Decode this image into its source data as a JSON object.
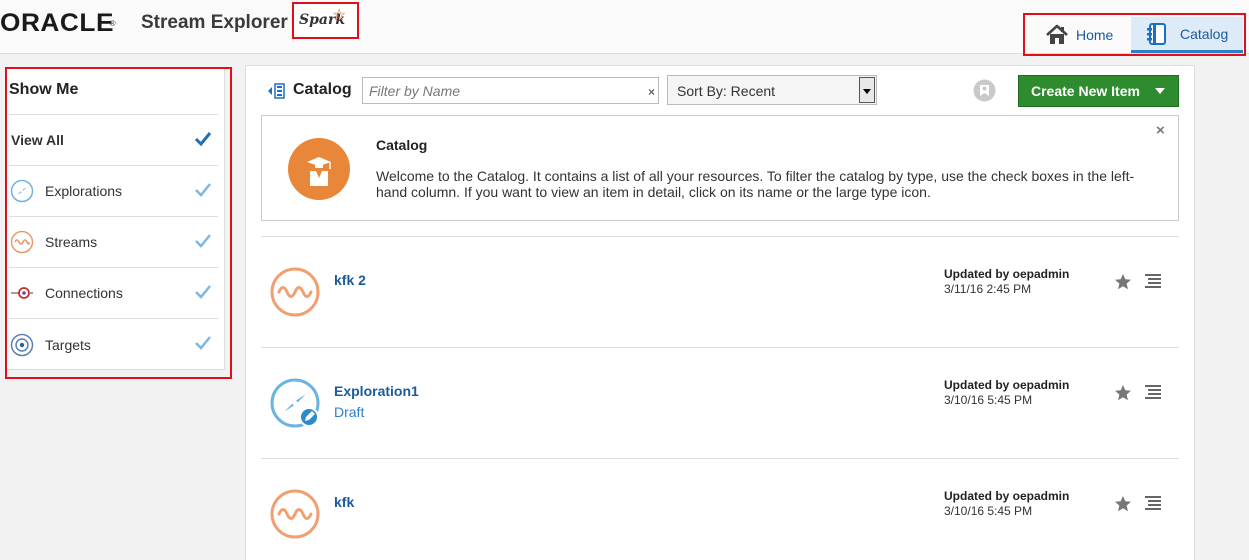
{
  "header": {
    "oracle_logo": "ORACLE",
    "oracle_reg": "®",
    "app_title": "Stream Explorer",
    "spark_logo": "Spark",
    "nav": [
      {
        "label": "Home",
        "icon": "home-icon",
        "active": false
      },
      {
        "label": "Catalog",
        "icon": "catalog-icon",
        "active": true
      }
    ]
  },
  "sidebar": {
    "title": "Show Me",
    "items": [
      {
        "label": "View All",
        "icon": "",
        "checked": true
      },
      {
        "label": "Explorations",
        "icon": "exploration-icon",
        "checked": true
      },
      {
        "label": "Streams",
        "icon": "stream-icon",
        "checked": true
      },
      {
        "label": "Connections",
        "icon": "connection-icon",
        "checked": true
      },
      {
        "label": "Targets",
        "icon": "target-icon",
        "checked": true
      }
    ]
  },
  "toolbar": {
    "title": "Catalog",
    "filter_placeholder": "Filter by Name",
    "filter_clear": "×",
    "sort_label": "Sort By: Recent",
    "create_label": "Create New Item"
  },
  "welcome": {
    "title": "Catalog",
    "text": "Welcome to the Catalog. It contains a list of all your resources. To filter the catalog by type, use the check boxes in the left-hand column. If you want to view an item in detail, click on its name or the large type icon.",
    "close": "×"
  },
  "items": [
    {
      "name": "kfk 2",
      "subtitle": "",
      "type": "stream",
      "updated_by": "Updated by oepadmin",
      "date": "3/11/16 2:45 PM"
    },
    {
      "name": "Exploration1",
      "subtitle": "Draft",
      "type": "exploration",
      "updated_by": "Updated by oepadmin",
      "date": "3/10/16 5:45 PM"
    },
    {
      "name": "kfk",
      "subtitle": "",
      "type": "stream",
      "updated_by": "Updated by oepadmin",
      "date": "3/10/16 5:45 PM"
    }
  ],
  "colors": {
    "accent_blue": "#1c5a9a",
    "create_green": "#2e8b2e",
    "stream_orange": "#f0a070",
    "exploration_blue": "#6ab4e0",
    "annotation_red": "#e0101b"
  }
}
